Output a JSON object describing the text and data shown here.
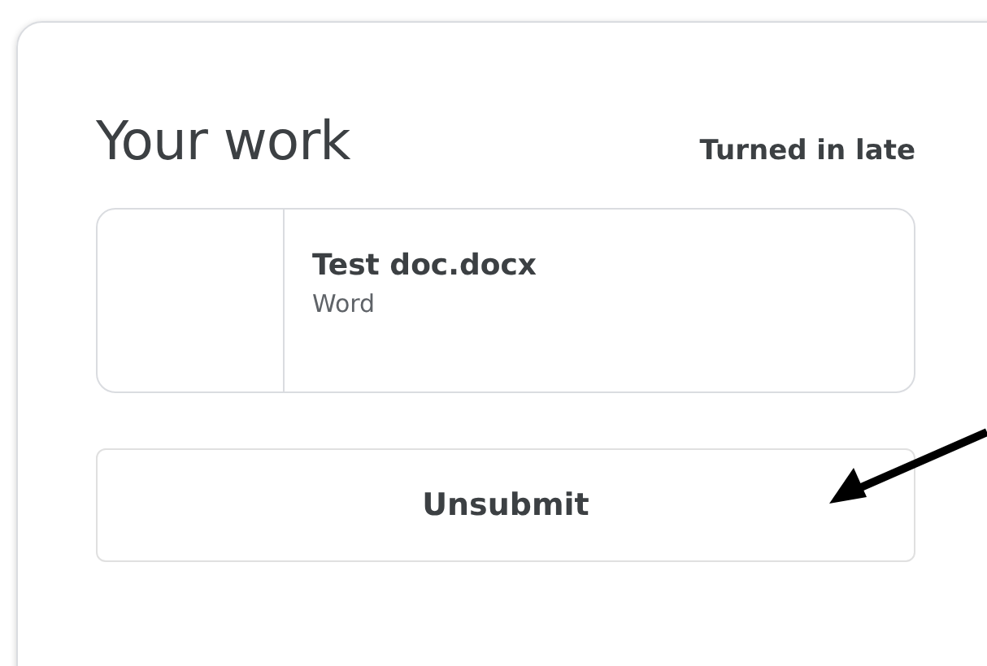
{
  "card": {
    "title": "Your work",
    "status": "Turned in late",
    "attachments": [
      {
        "name": "Test doc.docx",
        "type": "Word"
      }
    ],
    "button": "Unsubmit"
  }
}
